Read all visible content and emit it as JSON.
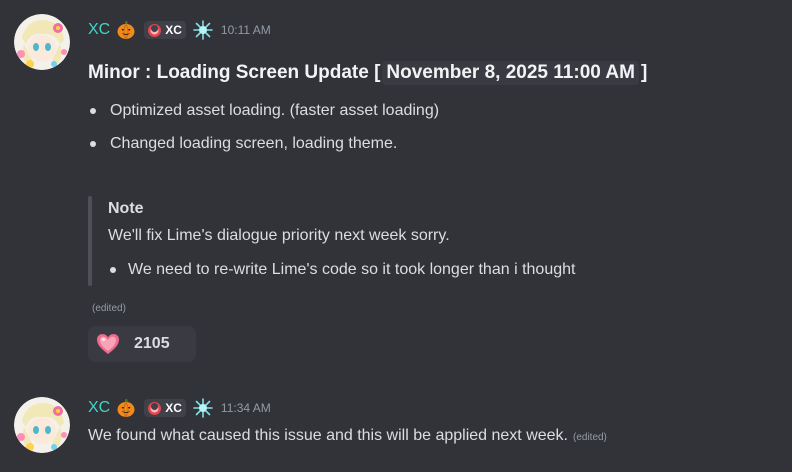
{
  "messages": [
    {
      "username": "XC",
      "tag": "XC",
      "time": "10:11 AM",
      "title_prefix": "Minor : Loading Screen Update [",
      "title_code": "November 8, 2025 11:00 AM",
      "title_suffix": "]",
      "bullets": [
        "Optimized asset loading. (faster asset loading)",
        "Changed loading screen, loading theme."
      ],
      "note": {
        "title": "Note",
        "text": "We'll fix Lime's dialogue priority next week sorry.",
        "bullets": [
          "We need to re-write Lime's code so it took longer than i thought"
        ]
      },
      "edited": "(edited)",
      "reaction": {
        "icon": "heart-emoji",
        "count": "2105"
      }
    },
    {
      "username": "XC",
      "tag": "XC",
      "time": "11:34 AM",
      "text": "We found what caused this issue and this will be applied next week.",
      "edited": "(edited)"
    }
  ],
  "colors": {
    "background": "#323339",
    "username": "#3fd5c8",
    "text": "#dbdee1",
    "muted": "#949ba4"
  }
}
